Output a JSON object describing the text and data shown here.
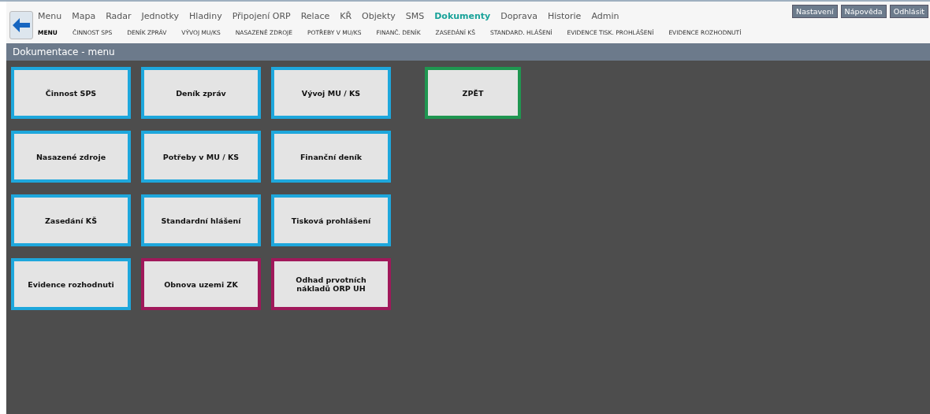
{
  "main_menu": [
    {
      "label": "Menu",
      "selected": false
    },
    {
      "label": "Mapa",
      "selected": false
    },
    {
      "label": "Radar",
      "selected": false
    },
    {
      "label": "Jednotky",
      "selected": false
    },
    {
      "label": "Hladiny",
      "selected": false
    },
    {
      "label": "Připojení ORP",
      "selected": false
    },
    {
      "label": "Relace",
      "selected": false
    },
    {
      "label": "KŘ",
      "selected": false
    },
    {
      "label": "Objekty",
      "selected": false
    },
    {
      "label": "SMS",
      "selected": false
    },
    {
      "label": "Dokumenty",
      "selected": true
    },
    {
      "label": "Doprava",
      "selected": false
    },
    {
      "label": "Historie",
      "selected": false
    },
    {
      "label": "Admin",
      "selected": false
    }
  ],
  "sub_menu": [
    {
      "label": "MENU",
      "selected": true
    },
    {
      "label": "ČINNOST SPS",
      "selected": false
    },
    {
      "label": "DENÍK ZPRÁV",
      "selected": false
    },
    {
      "label": "VÝVOJ MU/KS",
      "selected": false
    },
    {
      "label": "NASAZENÉ ZDROJE",
      "selected": false
    },
    {
      "label": "POTŘEBY V MU/KS",
      "selected": false
    },
    {
      "label": "FINANČ. DENÍK",
      "selected": false
    },
    {
      "label": "ZASEDÁNÍ KŠ",
      "selected": false
    },
    {
      "label": "STANDARD. HLÁŠENÍ",
      "selected": false
    },
    {
      "label": "EVIDENCE TISK. PROHLÁŠENÍ",
      "selected": false
    },
    {
      "label": "EVIDENCE ROZHODNUTÍ",
      "selected": false
    }
  ],
  "top_buttons": [
    "Nastavení",
    "Nápověda",
    "Odhlásit"
  ],
  "section_title": "Dokumentace - menu",
  "tiles": [
    {
      "label": "Činnost SPS",
      "color": "#1ea7dc"
    },
    {
      "label": "Deník zpráv",
      "color": "#1ea7dc"
    },
    {
      "label": "Vývoj MU / KS",
      "color": "#1ea7dc"
    },
    {
      "label": "ZPĚT",
      "color": "#1f9650",
      "kind": "back"
    },
    {
      "label": "Nasazené zdroje",
      "color": "#1ea7dc"
    },
    {
      "label": "Potřeby v MU / KS",
      "color": "#1ea7dc"
    },
    {
      "label": "Finanční deník",
      "color": "#1ea7dc"
    },
    {
      "label": "Zasedání KŠ",
      "color": "#1ea7dc"
    },
    {
      "label": "Standardní hlášení",
      "color": "#1ea7dc"
    },
    {
      "label": "Tisková prohlášení",
      "color": "#1ea7dc"
    },
    {
      "label": "Evidence rozhodnuti",
      "color": "#1ea7dc"
    },
    {
      "label": "Obnova uzemi ZK",
      "color": "#a0185a"
    },
    {
      "label": "Odhad prvotních nákladů ORP UH",
      "color": "#a0185a"
    }
  ]
}
